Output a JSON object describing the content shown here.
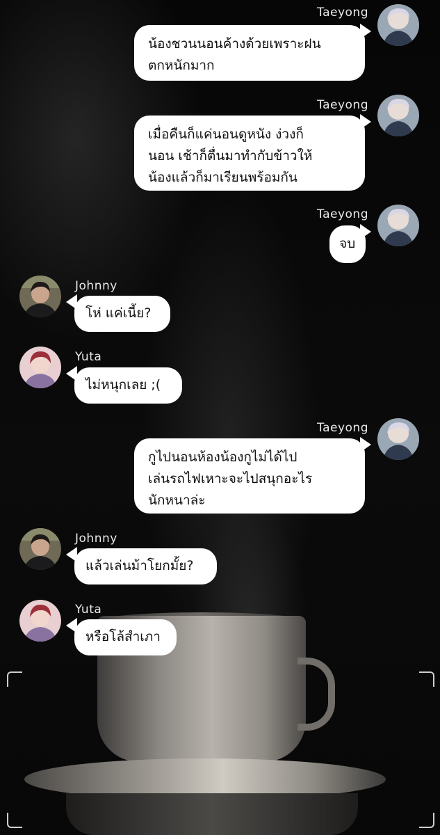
{
  "colors": {
    "bubble": "#ffffff",
    "bubble_text": "#111111",
    "name_text": "#e8e8e8",
    "background": "#000000"
  },
  "messages": [
    {
      "sender": "Taeyong",
      "side": "right",
      "lines": [
        "น้องชวนนอนค้างด้วยเพราะฝน",
        "ตกหนักมาก"
      ]
    },
    {
      "sender": "Taeyong",
      "side": "right",
      "lines": [
        "เมื่อคืนก็แค่นอนดูหนัง ง่วงก็",
        "นอน เช้าก็ตื่นมาทำกับข้าวให้",
        "น้องแล้วก็มาเรียนพร้อมกัน"
      ]
    },
    {
      "sender": "Taeyong",
      "side": "right",
      "lines": [
        "จบ"
      ]
    },
    {
      "sender": "Johnny",
      "side": "left",
      "lines": [
        "โห่ แค่เนี้ย?"
      ]
    },
    {
      "sender": "Yuta",
      "side": "left",
      "lines": [
        "ไม่หนุกเลย ;("
      ]
    },
    {
      "sender": "Taeyong",
      "side": "right",
      "lines": [
        "กูไปนอนห้องน้องกูไม่ได้ไป",
        "เล่นรถไฟเหาะจะไปสนุกอะไร",
        "นักหนาล่ะ"
      ]
    },
    {
      "sender": "Johnny",
      "side": "left",
      "lines": [
        "แล้วเล่นม้าโยกมั้ย?"
      ]
    },
    {
      "sender": "Yuta",
      "side": "left",
      "lines": [
        "หรือโล้สำเภา"
      ]
    }
  ],
  "avatars": {
    "Taeyong": "avatar-blond-hair",
    "Johnny": "avatar-dark-hair",
    "Yuta": "avatar-red-hair"
  }
}
